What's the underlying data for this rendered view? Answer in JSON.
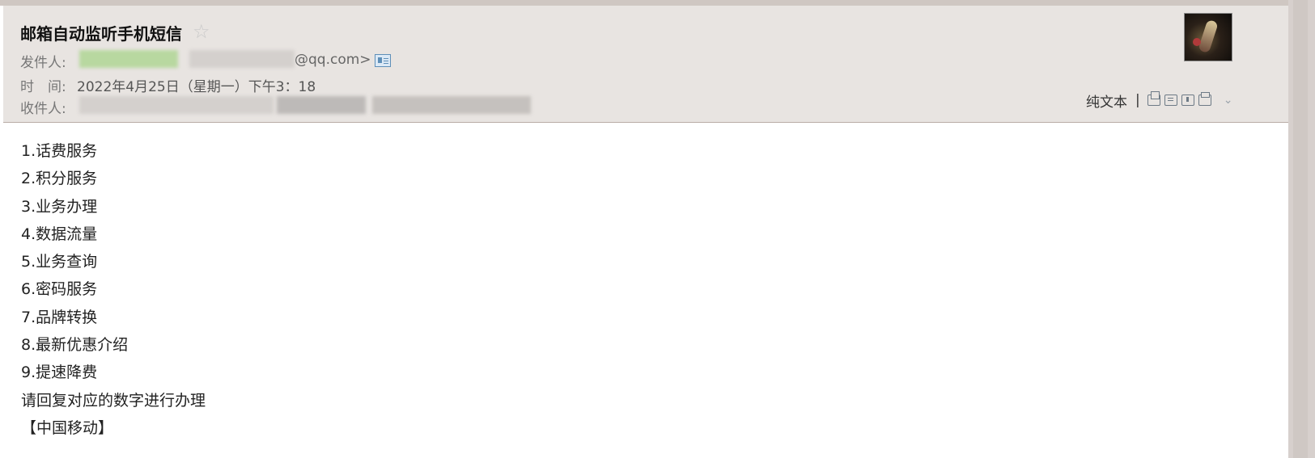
{
  "email": {
    "subject": "邮箱自动监听手机短信",
    "from_label": "发件人:",
    "from_visible": "@qq.com>",
    "time_label": "时　间:",
    "time_value": "2022年4月25日（星期一）下午3：18",
    "to_label": "收件人:"
  },
  "toolbar": {
    "plain_text": "纯文本",
    "separator": "|"
  },
  "body": {
    "lines": [
      "1.话费服务",
      "2.积分服务",
      "3.业务办理",
      "4.数据流量",
      "5.业务查询",
      "6.密码服务",
      "7.品牌转换",
      "8.最新优惠介绍",
      "9.提速降费",
      "请回复对应的数字进行办理",
      "【中国移动】"
    ]
  },
  "icons": {
    "star": "star-icon",
    "contact_card": "contact-card-icon",
    "new_window": "new-window-icon",
    "note": "note-icon",
    "save": "save-icon",
    "print": "print-icon",
    "more": "chevron-down-icon"
  },
  "colors": {
    "header_bg": "#e8e4e1",
    "header_border": "#b9aca6",
    "scrollbar": "#d7d0cd",
    "label_text": "#777777",
    "body_text": "#222222"
  }
}
